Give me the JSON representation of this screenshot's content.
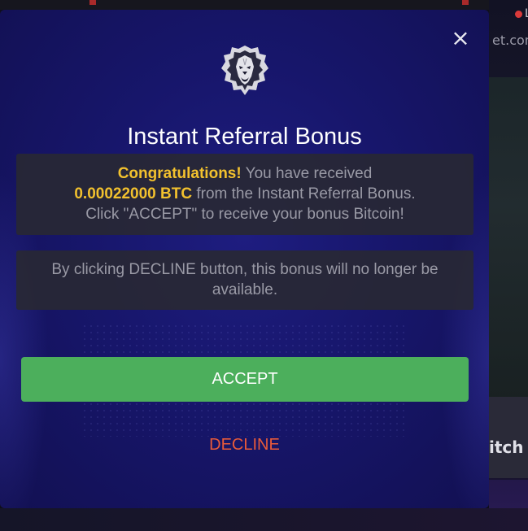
{
  "background": {
    "site_fragment_top": "L",
    "site_fragment_url": "et.com",
    "site_fragment_brand": "itch"
  },
  "modal": {
    "close_label": "×",
    "logo_icon": "lion-head-icon",
    "title": "Instant Referral Bonus",
    "info_box": {
      "congrats": "Congratulations!",
      "received_text": " You have received",
      "amount": "0.00022000 BTC",
      "from_text": " from the Instant Referral Bonus.",
      "instruction": "Click \"ACCEPT\" to receive your bonus Bitcoin!"
    },
    "warning_box": {
      "text": "By clicking DECLINE button, this bonus will no longer be available."
    },
    "accept_label": "ACCEPT",
    "decline_label": "DECLINE"
  },
  "colors": {
    "modal_bg": "#17166b",
    "highlight": "#f2c12e",
    "accept_bg": "#4caf5c",
    "decline_text": "#e85a3a"
  }
}
